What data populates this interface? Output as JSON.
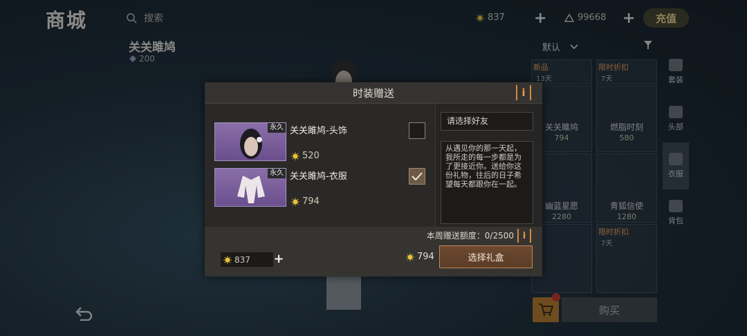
{
  "shop": {
    "title": "商城",
    "search_placeholder": "搜索",
    "character_name": "关关雎鸠",
    "character_price": "200",
    "currency_gold": "837",
    "currency_points": "99668",
    "recharge_label": "充值",
    "sort_label": "默认",
    "side_tabs": [
      "套装",
      "头部",
      "衣服",
      "背包"
    ],
    "cards": [
      {
        "tag": "新品",
        "days": "13天",
        "name": "",
        "price": ""
      },
      {
        "tag": "限时折扣",
        "days": "7天",
        "name": "",
        "price": ""
      },
      {
        "tag": "",
        "days": "",
        "name": "关关雎鸠",
        "price": "794"
      },
      {
        "tag": "",
        "days": "",
        "name": "燃脂时刻",
        "price": "580"
      },
      {
        "tag": "",
        "days": "",
        "name": "幽蓝星愿",
        "price": "2280"
      },
      {
        "tag": "",
        "days": "",
        "name": "青狐信使",
        "price": "1280"
      },
      {
        "tag": "",
        "days": "",
        "name": "",
        "price": ""
      },
      {
        "tag": "限时折扣",
        "days": "7天",
        "name": "",
        "price": ""
      }
    ],
    "buy_label": "购买"
  },
  "dialog": {
    "title": "时装赠送",
    "items": [
      {
        "tag": "永久",
        "name": "关关雎鸠-头饰",
        "price": "520",
        "checked": false
      },
      {
        "tag": "永久",
        "name": "关关雎鸠-衣服",
        "price": "794",
        "checked": true
      }
    ],
    "friend_placeholder": "请选择好友",
    "message": "从遇见你的那一天起，我所走的每一步都是为了更接近你。送给你这份礼物，往后的日子希望每天都跟你在一起。",
    "quota_label": "本周赠送额度：0/2500",
    "wallet_amount": "837",
    "total_amount": "794",
    "gift_box_button": "选择礼盒"
  },
  "colors": {
    "accent_orange": "#d58a3a",
    "coin_yellow": "#e8c33a",
    "dialog_bg": "#2b2a28",
    "item_purple": "#7a5e9c"
  }
}
